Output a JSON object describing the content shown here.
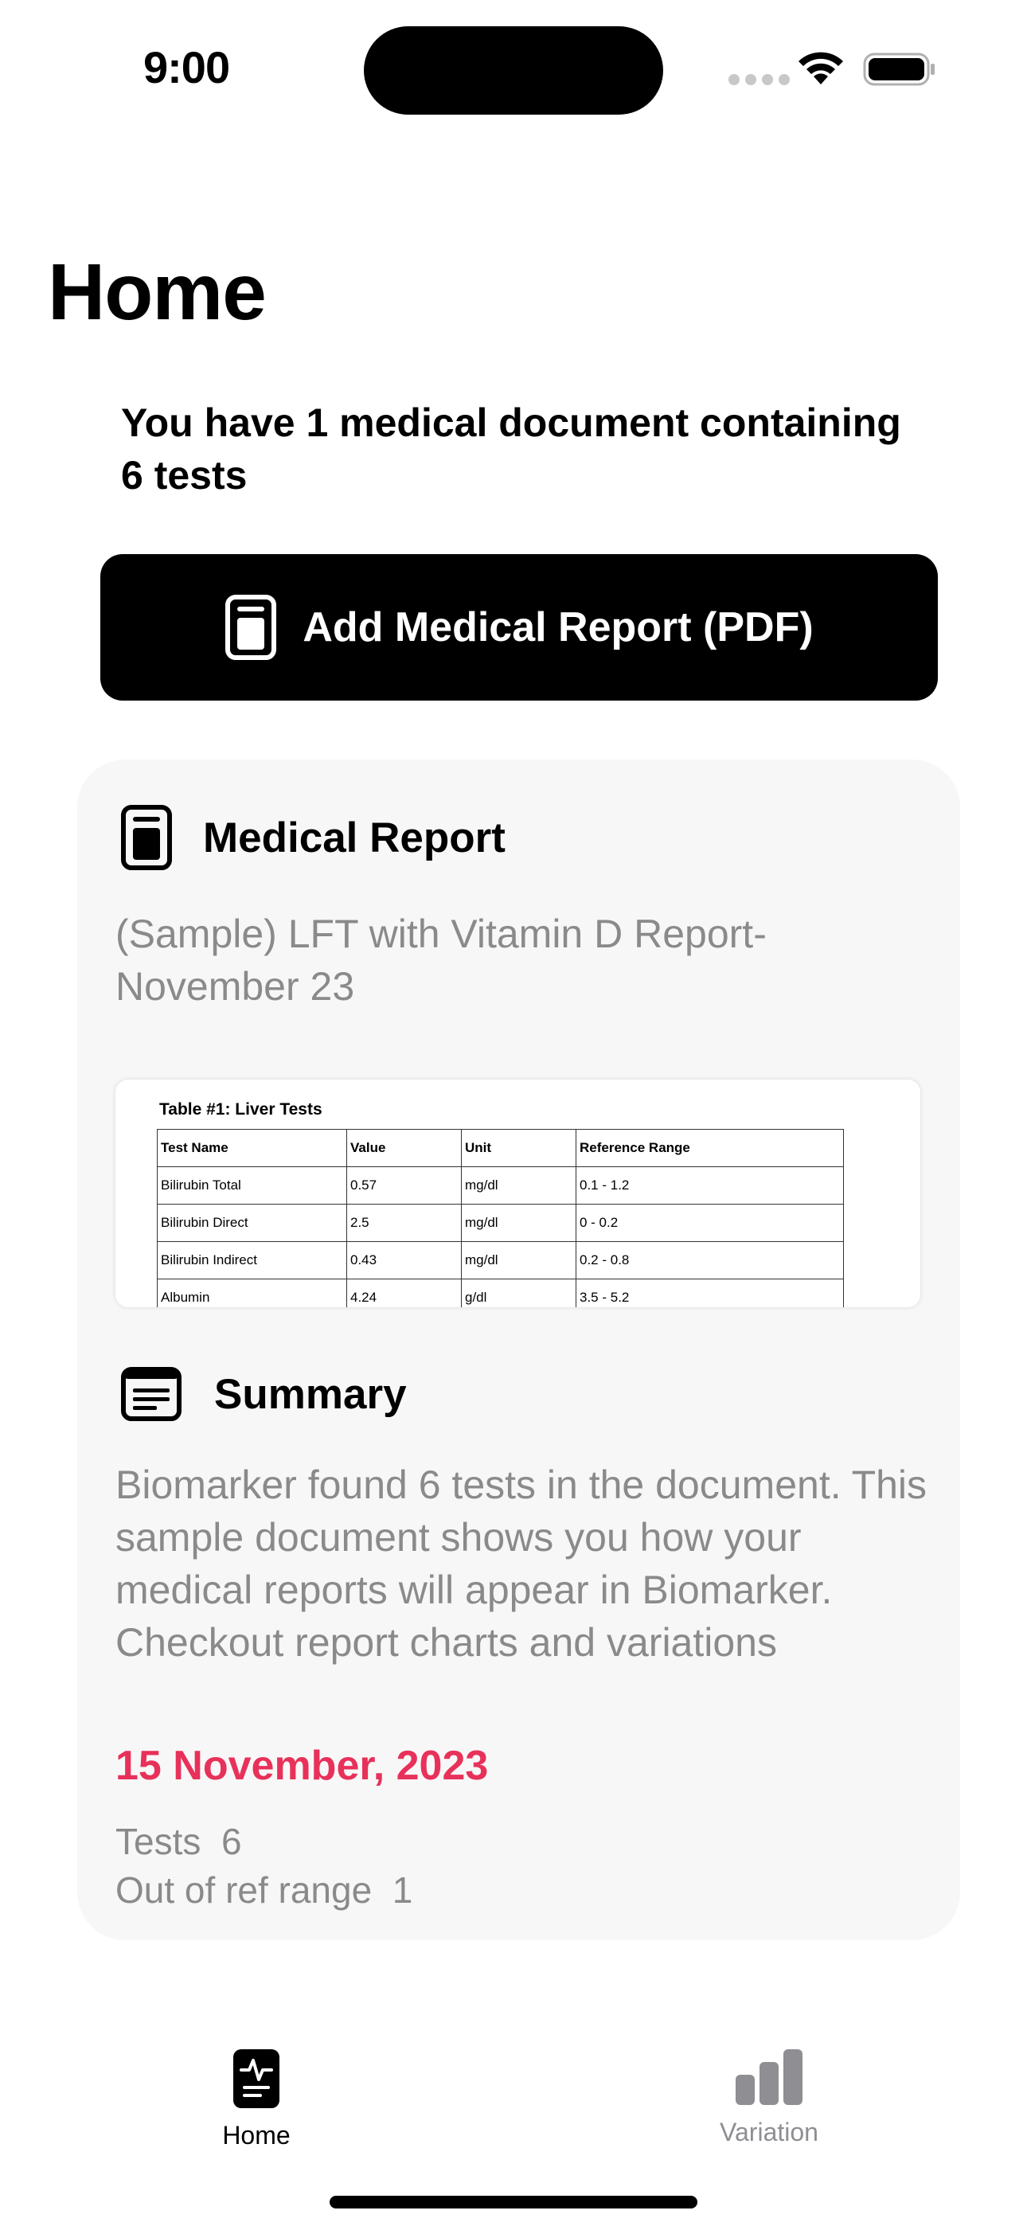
{
  "status_bar": {
    "time": "9:00"
  },
  "header": {
    "title": "Home",
    "document_summary": "You have 1 medical document containing 6 tests"
  },
  "add_button": {
    "label": "Add Medical Report (PDF)",
    "icon": "document-icon"
  },
  "report_card": {
    "section_title": "Medical Report",
    "section_icon": "document-icon",
    "report_name": "(Sample) LFT with Vitamin D Report- November 23",
    "preview": {
      "table_title": "Table #1: Liver Tests",
      "columns": [
        "Test Name",
        "Value",
        "Unit",
        "Reference Range"
      ],
      "rows": [
        [
          "Bilirubin Total",
          "0.57",
          "mg/dl",
          "0.1 - 1.2"
        ],
        [
          "Bilirubin Direct",
          "2.5",
          "mg/dl",
          "0 - 0.2"
        ],
        [
          "Bilirubin Indirect",
          "0.43",
          "mg/dl",
          "0.2 - 0.8"
        ],
        [
          "Albumin",
          "4.24",
          "g/dl",
          "3.5 - 5.2"
        ]
      ]
    },
    "summary_title": "Summary",
    "summary_icon": "summary-icon",
    "summary_text": "Biomarker found 6 tests in the document. This sample document shows you how your medical reports will appear in Biomarker. Checkout report charts and variations",
    "date": "15 November, 2023",
    "tests_label": "Tests",
    "tests_value": "6",
    "out_of_range_label": "Out of ref range",
    "out_of_range_value": "1"
  },
  "tab_bar": {
    "tabs": [
      {
        "label": "Home",
        "icon": "health-report-icon",
        "selected": true
      },
      {
        "label": "Variation",
        "icon": "bar-chart-icon",
        "selected": false
      }
    ]
  },
  "colors": {
    "accent_date": "#e8315a",
    "secondary_text": "#8a8a8a",
    "card_background": "#f7f7f7",
    "tab_inactive": "#8e8e93"
  }
}
